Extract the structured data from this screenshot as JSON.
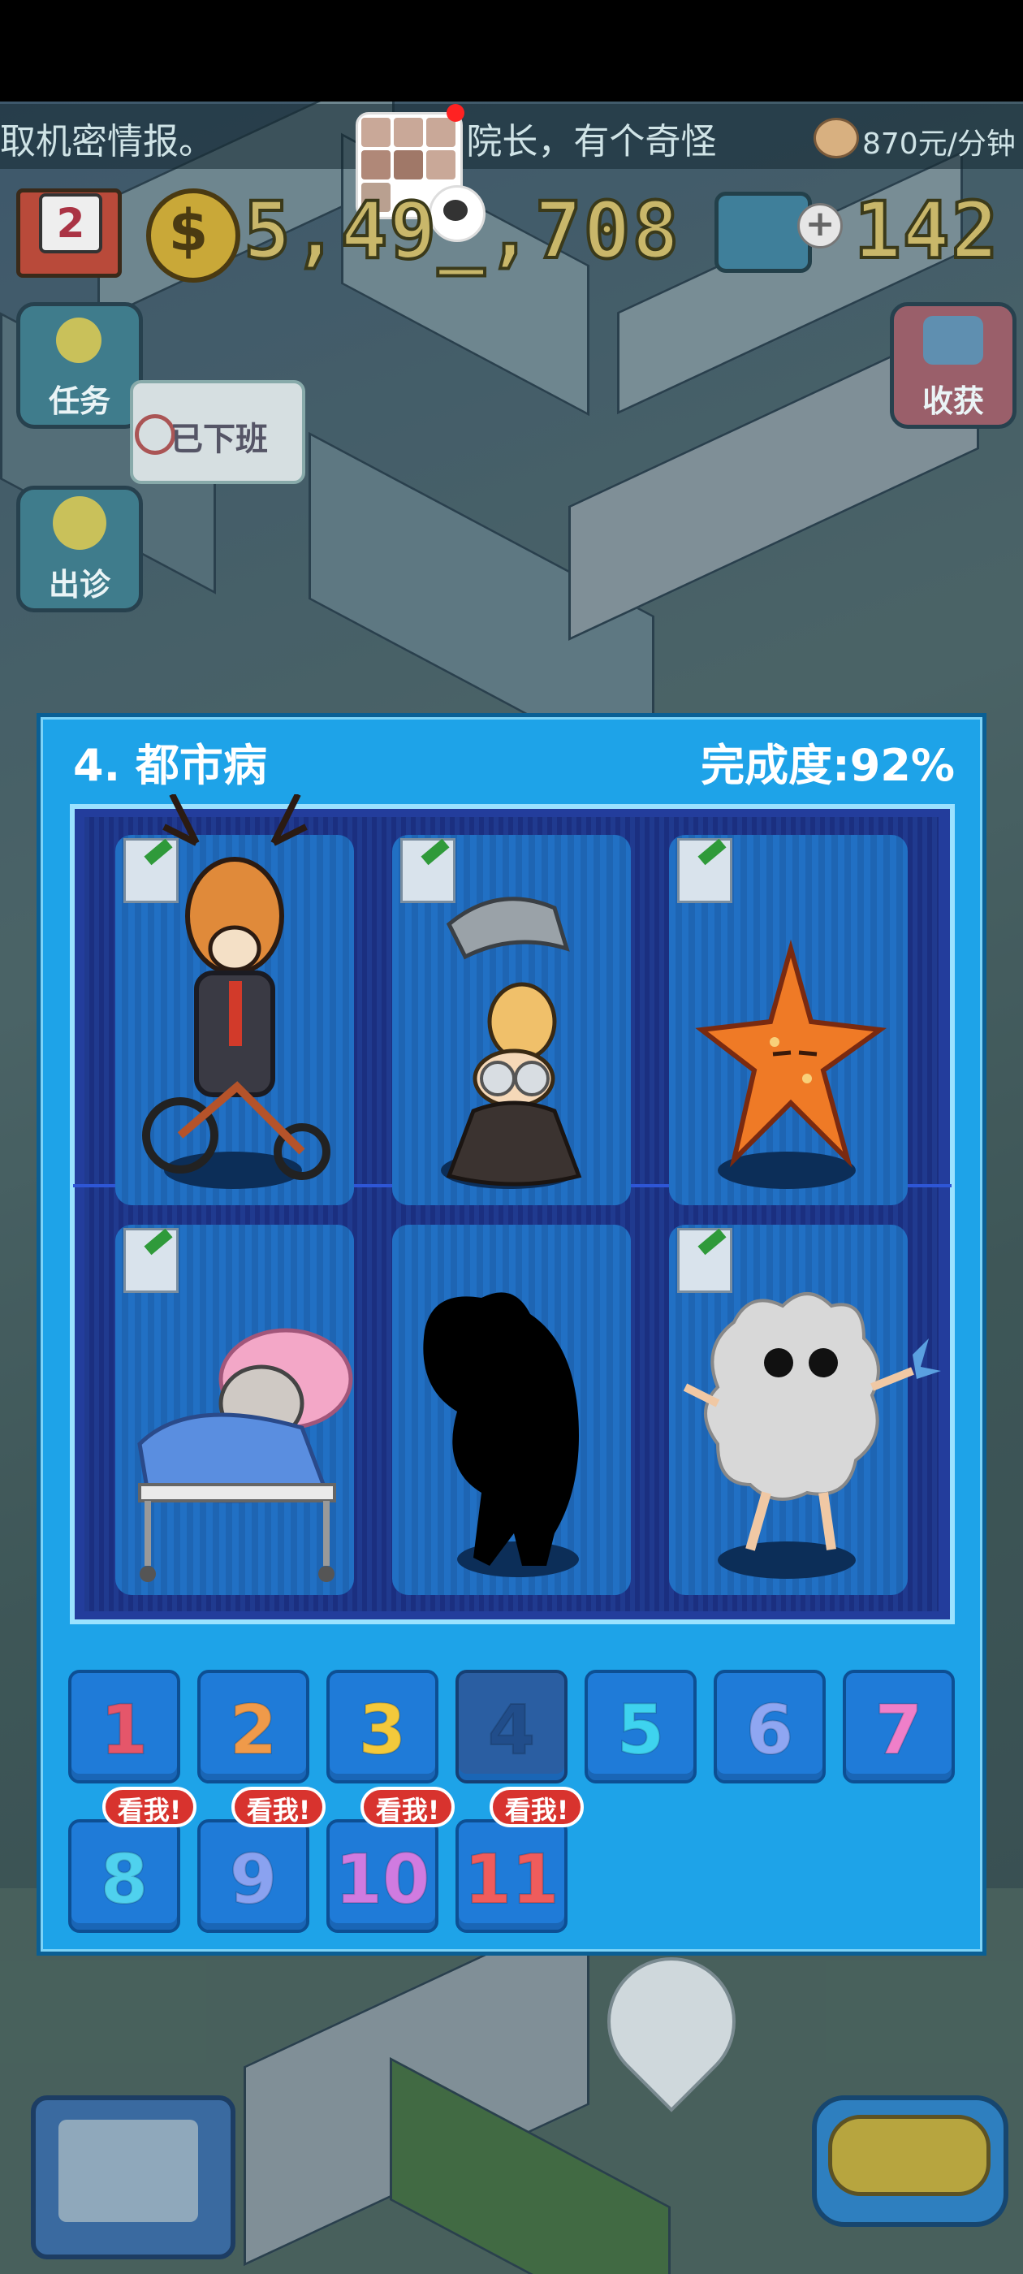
{
  "ticker": {
    "text": "取机密情报。",
    "text2": "[发] 院长，有个奇怪",
    "income": "870元/分钟"
  },
  "resources": {
    "level": "2",
    "coin_symbol": "$",
    "coins": "5,49_,708",
    "gems": "142"
  },
  "side_buttons": {
    "task": "任务",
    "harvest": "收获",
    "visit": "出诊",
    "off_duty": "已下班"
  },
  "modal": {
    "title": "4. 都市病",
    "progress": "完成度:92%",
    "cards": [
      {
        "name": "deer-on-tricycle",
        "collected": true
      },
      {
        "name": "mermaid-with-dolphin",
        "collected": true
      },
      {
        "name": "starfish",
        "collected": true
      },
      {
        "name": "sloth-in-bed",
        "collected": true
      },
      {
        "name": "silhouette",
        "collected": false
      },
      {
        "name": "cloud-creature",
        "collected": true
      }
    ],
    "tabs": [
      {
        "label": "1",
        "color": "#e5566a"
      },
      {
        "label": "2",
        "color": "#ef9a4a"
      },
      {
        "label": "3",
        "color": "#f3c93b"
      },
      {
        "label": "4",
        "color": "#214d8a"
      },
      {
        "label": "5",
        "color": "#3ed3ef"
      },
      {
        "label": "6",
        "color": "#8fa6f2"
      },
      {
        "label": "7",
        "color": "#ef7fc9"
      },
      {
        "label": "8",
        "color": "#4fd1ee"
      },
      {
        "label": "9",
        "color": "#8aa2f0"
      },
      {
        "label": "10",
        "color": "#d07be0"
      },
      {
        "label": "11",
        "color": "#ef5c5c"
      }
    ],
    "look_label": "看我!",
    "active_tab": "4"
  },
  "colors": {
    "modal_bg": "#1ea3e8",
    "card_bg": "#1e67b8",
    "look_badge": "#d8332e"
  }
}
